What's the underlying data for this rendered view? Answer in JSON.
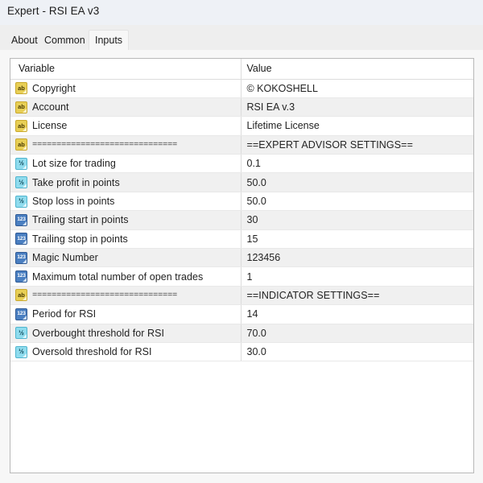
{
  "window": {
    "title": "Expert - RSI EA v3"
  },
  "tabs": [
    {
      "label": "About",
      "selected": false
    },
    {
      "label": "Common",
      "selected": false
    },
    {
      "label": "Inputs",
      "selected": true
    }
  ],
  "table": {
    "headers": {
      "variable": "Variable",
      "value": "Value"
    },
    "rows": [
      {
        "icon": "string-type-icon",
        "icon_glyph": "ab",
        "type": "string",
        "variable": "Copyright",
        "value": "© KOKOSHELL"
      },
      {
        "icon": "string-type-icon",
        "icon_glyph": "ab",
        "type": "string",
        "variable": "Account",
        "value": "RSI EA v.3"
      },
      {
        "icon": "string-type-icon",
        "icon_glyph": "ab",
        "type": "string",
        "variable": "License",
        "value": "Lifetime License"
      },
      {
        "icon": "string-type-icon",
        "icon_glyph": "ab",
        "type": "string",
        "variable": "==============================",
        "value": "==EXPERT ADVISOR SETTINGS==",
        "separator": true
      },
      {
        "icon": "double-type-icon",
        "icon_glyph": "½",
        "type": "double",
        "variable": "Lot size for trading",
        "value": "0.1"
      },
      {
        "icon": "double-type-icon",
        "icon_glyph": "½",
        "type": "double",
        "variable": "Take profit in points",
        "value": "50.0"
      },
      {
        "icon": "double-type-icon",
        "icon_glyph": "½",
        "type": "double",
        "variable": "Stop loss in points",
        "value": "50.0"
      },
      {
        "icon": "integer-type-icon",
        "icon_glyph": "123",
        "type": "int",
        "variable": "Trailing start in points",
        "value": "30"
      },
      {
        "icon": "integer-type-icon",
        "icon_glyph": "123",
        "type": "int",
        "variable": "Trailing stop in points",
        "value": "15"
      },
      {
        "icon": "integer-type-icon",
        "icon_glyph": "123",
        "type": "int",
        "variable": "Magic Number",
        "value": "123456"
      },
      {
        "icon": "integer-type-icon",
        "icon_glyph": "123",
        "type": "int",
        "variable": "Maximum total number of open trades",
        "value": "1"
      },
      {
        "icon": "string-type-icon",
        "icon_glyph": "ab",
        "type": "string",
        "variable": "==============================",
        "value": "==INDICATOR SETTINGS==",
        "separator": true
      },
      {
        "icon": "integer-type-icon",
        "icon_glyph": "123",
        "type": "int",
        "variable": "Period for RSI",
        "value": "14"
      },
      {
        "icon": "double-type-icon",
        "icon_glyph": "½",
        "type": "double",
        "variable": "Overbought threshold for RSI",
        "value": "70.0"
      },
      {
        "icon": "double-type-icon",
        "icon_glyph": "½",
        "type": "double",
        "variable": "Oversold threshold for RSI",
        "value": "30.0"
      }
    ]
  },
  "colors": {
    "titlebar_bg": "#eef1f6",
    "tabstrip_bg": "#eeeeee",
    "panel_bg": "#f7f7f7",
    "row_alt_bg": "#f0f0f0",
    "grid_border": "#b8b8b8",
    "string_icon": "#e8cf55",
    "double_icon": "#8fdcee",
    "integer_icon": "#4a7fc1"
  }
}
